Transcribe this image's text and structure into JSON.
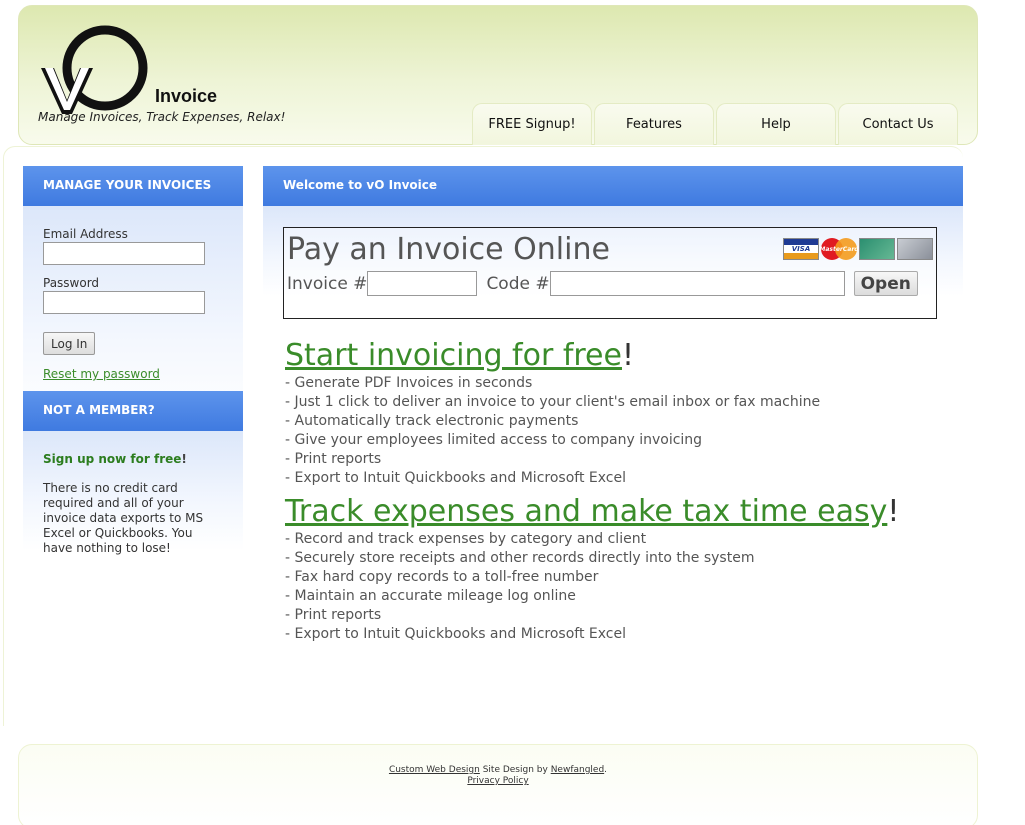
{
  "header": {
    "logo_word": "Invoice",
    "tagline": "Manage Invoices, Track Expenses, Relax!"
  },
  "nav": {
    "tabs": [
      {
        "label": "FREE Signup!"
      },
      {
        "label": "Features"
      },
      {
        "label": "Help"
      },
      {
        "label": "Contact Us"
      }
    ]
  },
  "sidebar": {
    "login": {
      "title": "MANAGE YOUR INVOICES",
      "email_label": "Email Address",
      "email_value": "",
      "password_label": "Password",
      "password_value": "",
      "login_button": "Log In",
      "reset_link": "Reset my password"
    },
    "member": {
      "title": "NOT A MEMBER?",
      "signup_link": "Sign up now for free",
      "signup_bang": "!",
      "text": "There is no credit card required and all of your invoice data exports to MS Excel or Quickbooks.  You have nothing to lose!"
    }
  },
  "main": {
    "header": "Welcome to vO Invoice",
    "pay": {
      "title": "Pay an Invoice Online",
      "invoice_label": "Invoice #",
      "invoice_value": "",
      "code_label": "Code #",
      "code_value": "",
      "open_button": "Open",
      "cards": [
        {
          "name": "visa-card-icon",
          "label": "VISA"
        },
        {
          "name": "mastercard-icon",
          "label": "MasterCard"
        },
        {
          "name": "amex-card-icon",
          "label": ""
        },
        {
          "name": "discover-card-icon",
          "label": ""
        }
      ]
    },
    "sections": [
      {
        "title": "Start invoicing for free",
        "excl": "!",
        "items": [
          "- Generate PDF Invoices in seconds",
          "- Just 1 click to deliver an invoice to your client's email inbox or fax machine",
          "- Automatically track electronic payments",
          "- Give your employees limited access to company invoicing",
          "- Print reports",
          "- Export to Intuit Quickbooks and Microsoft Excel"
        ]
      },
      {
        "title": "Track expenses and make tax time easy",
        "excl": "!",
        "items": [
          "- Record and track expenses by category and client",
          "- Securely store receipts and other records directly into the system",
          "- Fax hard copy records to a toll-free number",
          "- Maintain an accurate mileage log online",
          "- Print reports",
          "- Export to Intuit Quickbooks and Microsoft Excel"
        ]
      }
    ]
  },
  "footer": {
    "link1": "Custom Web Design",
    "text1": " Site Design by ",
    "link2": "Newfangled",
    "text2": ".",
    "privacy": "Privacy Policy"
  },
  "colors": {
    "accent_blue": "#4a86e8",
    "link_green": "#3a8c2a",
    "header_green": "#dde8b0"
  }
}
